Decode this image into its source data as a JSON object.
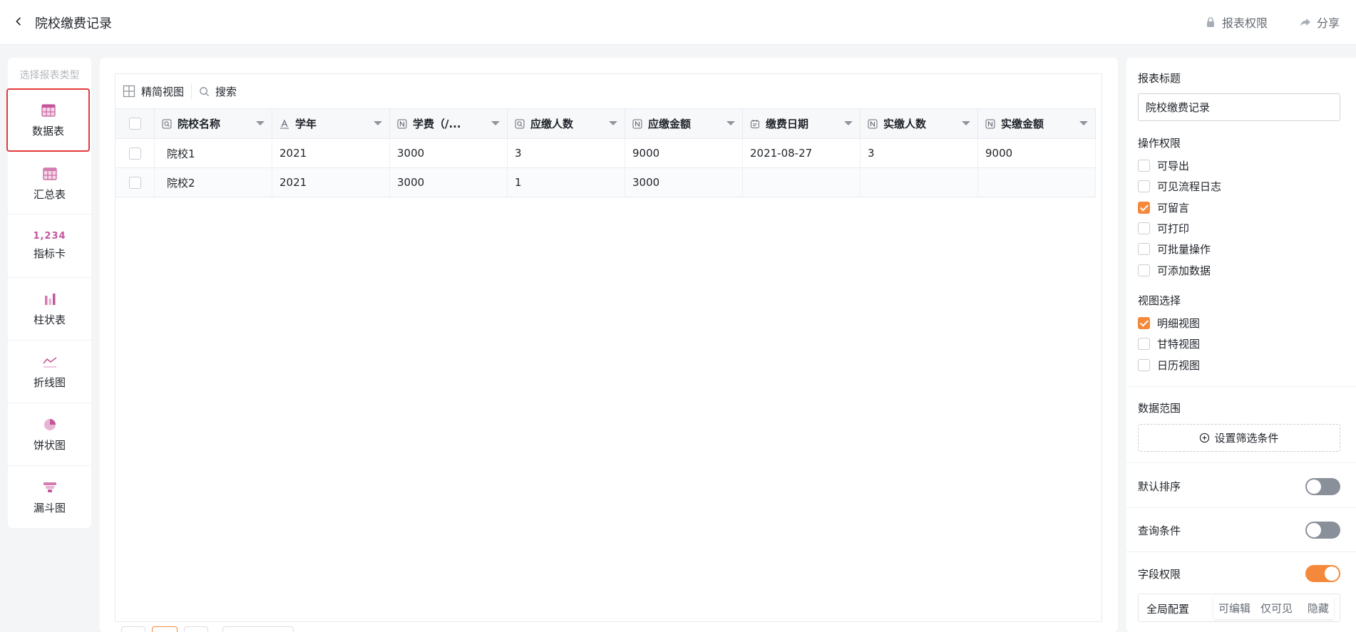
{
  "header": {
    "title": "院校缴费记录",
    "permission_label": "报表权限",
    "share_label": "分享"
  },
  "left_panel": {
    "title": "选择报表类型",
    "items": [
      {
        "label": "数据表",
        "icon": "table-icon",
        "active": true
      },
      {
        "label": "汇总表",
        "icon": "summary-table-icon"
      },
      {
        "label": "指标卡",
        "icon": "metric-card-icon",
        "icon_text": "1,234"
      },
      {
        "label": "柱状表",
        "icon": "bar-chart-icon"
      },
      {
        "label": "折线图",
        "icon": "line-chart-icon"
      },
      {
        "label": "饼状图",
        "icon": "pie-chart-icon"
      },
      {
        "label": "漏斗图",
        "icon": "funnel-chart-icon"
      }
    ]
  },
  "toolbar": {
    "view_label": "精简视图",
    "search_label": "搜索"
  },
  "table": {
    "columns": [
      {
        "label": "院校名称",
        "icon": "lookup-field-icon"
      },
      {
        "label": "学年",
        "icon": "text-field-icon"
      },
      {
        "label": "学费（/...",
        "icon": "number-field-icon"
      },
      {
        "label": "应缴人数",
        "icon": "lookup-field-icon"
      },
      {
        "label": "应缴金额",
        "icon": "number-field-icon"
      },
      {
        "label": "缴费日期",
        "icon": "date-field-icon"
      },
      {
        "label": "实缴人数",
        "icon": "number-field-icon"
      },
      {
        "label": "实缴金额",
        "icon": "number-field-icon"
      }
    ],
    "rows": [
      [
        "院校1",
        "2021",
        "3000",
        "3",
        "9000",
        "2021-08-27",
        "3",
        "9000"
      ],
      [
        "院校2",
        "2021",
        "3000",
        "1",
        "3000",
        "",
        "",
        ""
      ]
    ]
  },
  "settings": {
    "report_title_label": "报表标题",
    "report_title_value": "院校缴费记录",
    "op_permissions_label": "操作权限",
    "op_permissions": [
      {
        "label": "可导出",
        "checked": false
      },
      {
        "label": "可见流程日志",
        "checked": false
      },
      {
        "label": "可留言",
        "checked": true
      },
      {
        "label": "可打印",
        "checked": false
      },
      {
        "label": "可批量操作",
        "checked": false
      },
      {
        "label": "可添加数据",
        "checked": false
      }
    ],
    "view_select_label": "视图选择",
    "views": [
      {
        "label": "明细视图",
        "checked": true
      },
      {
        "label": "甘特视图",
        "checked": false
      },
      {
        "label": "日历视图",
        "checked": false
      }
    ],
    "data_range_label": "数据范围",
    "filter_button_label": "设置筛选条件",
    "default_sort_label": "默认排序",
    "default_sort_on": false,
    "query_condition_label": "查询条件",
    "query_condition_on": false,
    "field_permission_label": "字段权限",
    "field_permission_on": true,
    "global_config_label": "全局配置",
    "segments": [
      "可编辑",
      "仅可见",
      "隐藏"
    ]
  },
  "colors": {
    "accent": "#f5893b",
    "active_border": "#e5393a",
    "icon_pink": "#c4569a"
  }
}
